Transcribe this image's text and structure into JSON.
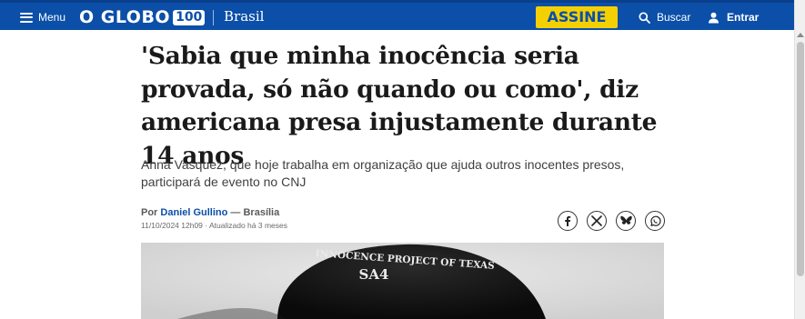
{
  "header": {
    "menu_label": "Menu",
    "logo_text": "O GLOBO",
    "logo_badge": "100",
    "section": "Brasil",
    "subscribe_label": "ASSINE",
    "search_label": "Buscar",
    "login_label": "Entrar"
  },
  "article": {
    "headline": "'Sabia que minha inocência seria provada, só não quando ou como', diz americana presa injustamente durante 14 anos",
    "subtitle": "Anna Vasquez, que hoje trabalha em organização que ajuda outros inocentes presos, participará de evento no CNJ",
    "byline_prefix": "Por",
    "author": "Daniel Gullino",
    "location": "— Brasília",
    "dateline": "11/10/2024 12h09 · Atualizado há 3 meses",
    "hero_caption_line1": "INNOCENCE PROJECT OF TEXAS",
    "hero_caption_line2": "SA4"
  },
  "share_icons": [
    "facebook-icon",
    "x-icon",
    "bluesky-icon",
    "whatsapp-icon"
  ],
  "colors": {
    "brand_blue": "#0b4fa8",
    "subscribe_yellow": "#f5d000",
    "headline_text": "#1a1a1a"
  }
}
